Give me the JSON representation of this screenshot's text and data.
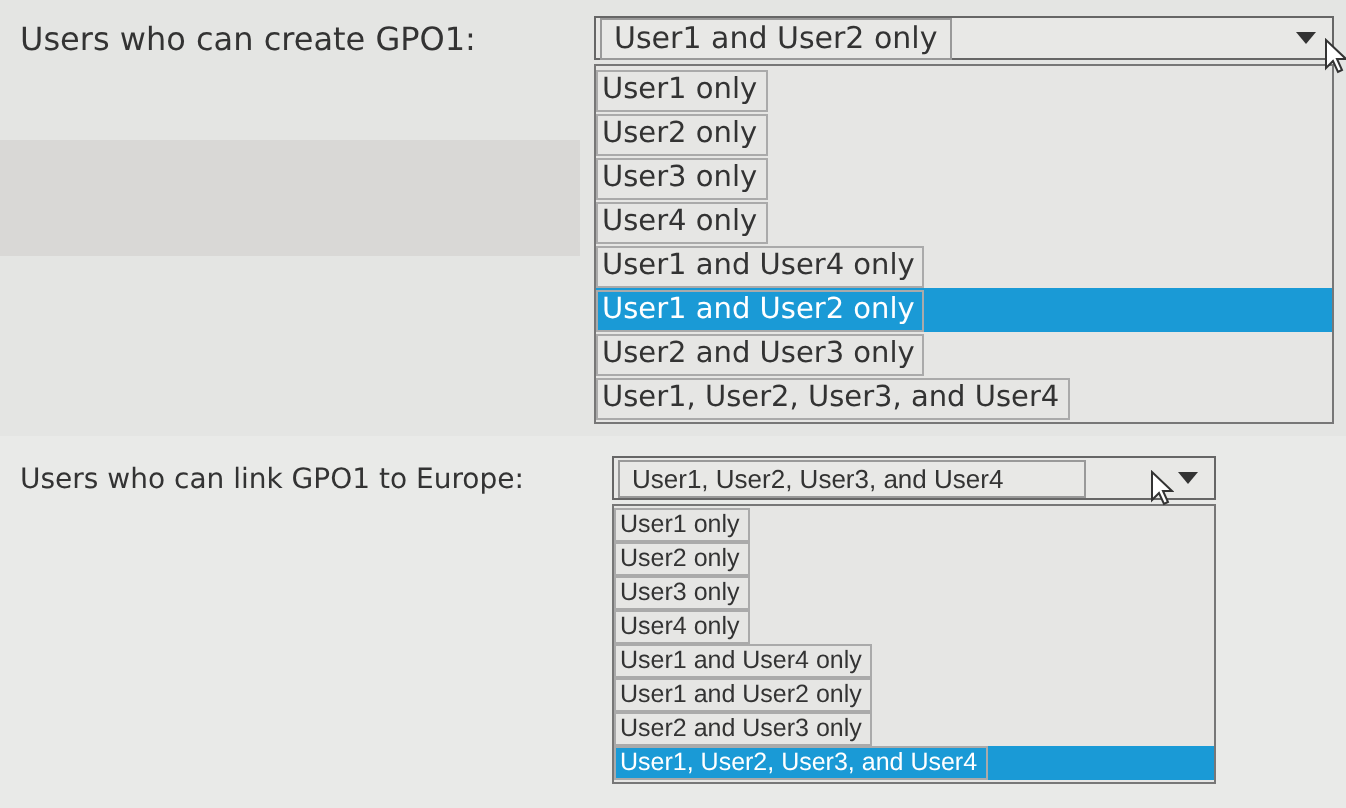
{
  "questions": [
    {
      "label": "Users who can create GPO1:",
      "value": "User1 and User2 only",
      "options": [
        {
          "text": "User1 only",
          "selected": false
        },
        {
          "text": "User2 only",
          "selected": false
        },
        {
          "text": "User3 only",
          "selected": false
        },
        {
          "text": "User4 only",
          "selected": false
        },
        {
          "text": "User1 and User4 only",
          "selected": false
        },
        {
          "text": "User1 and User2 only",
          "selected": true
        },
        {
          "text": "User2 and User3 only",
          "selected": false
        },
        {
          "text": "User1, User2, User3, and User4",
          "selected": false
        }
      ]
    },
    {
      "label": "Users who can link GPO1 to Europe:",
      "value": "User1, User2, User3, and User4",
      "options": [
        {
          "text": "User1 only",
          "selected": false
        },
        {
          "text": "User2 only",
          "selected": false
        },
        {
          "text": "User3 only",
          "selected": false
        },
        {
          "text": "User4 only",
          "selected": false
        },
        {
          "text": "User1 and User4 only",
          "selected": false
        },
        {
          "text": "User1 and User2 only",
          "selected": false
        },
        {
          "text": "User2 and User3 only",
          "selected": false
        },
        {
          "text": "User1, User2, User3, and User4",
          "selected": true
        }
      ]
    }
  ]
}
